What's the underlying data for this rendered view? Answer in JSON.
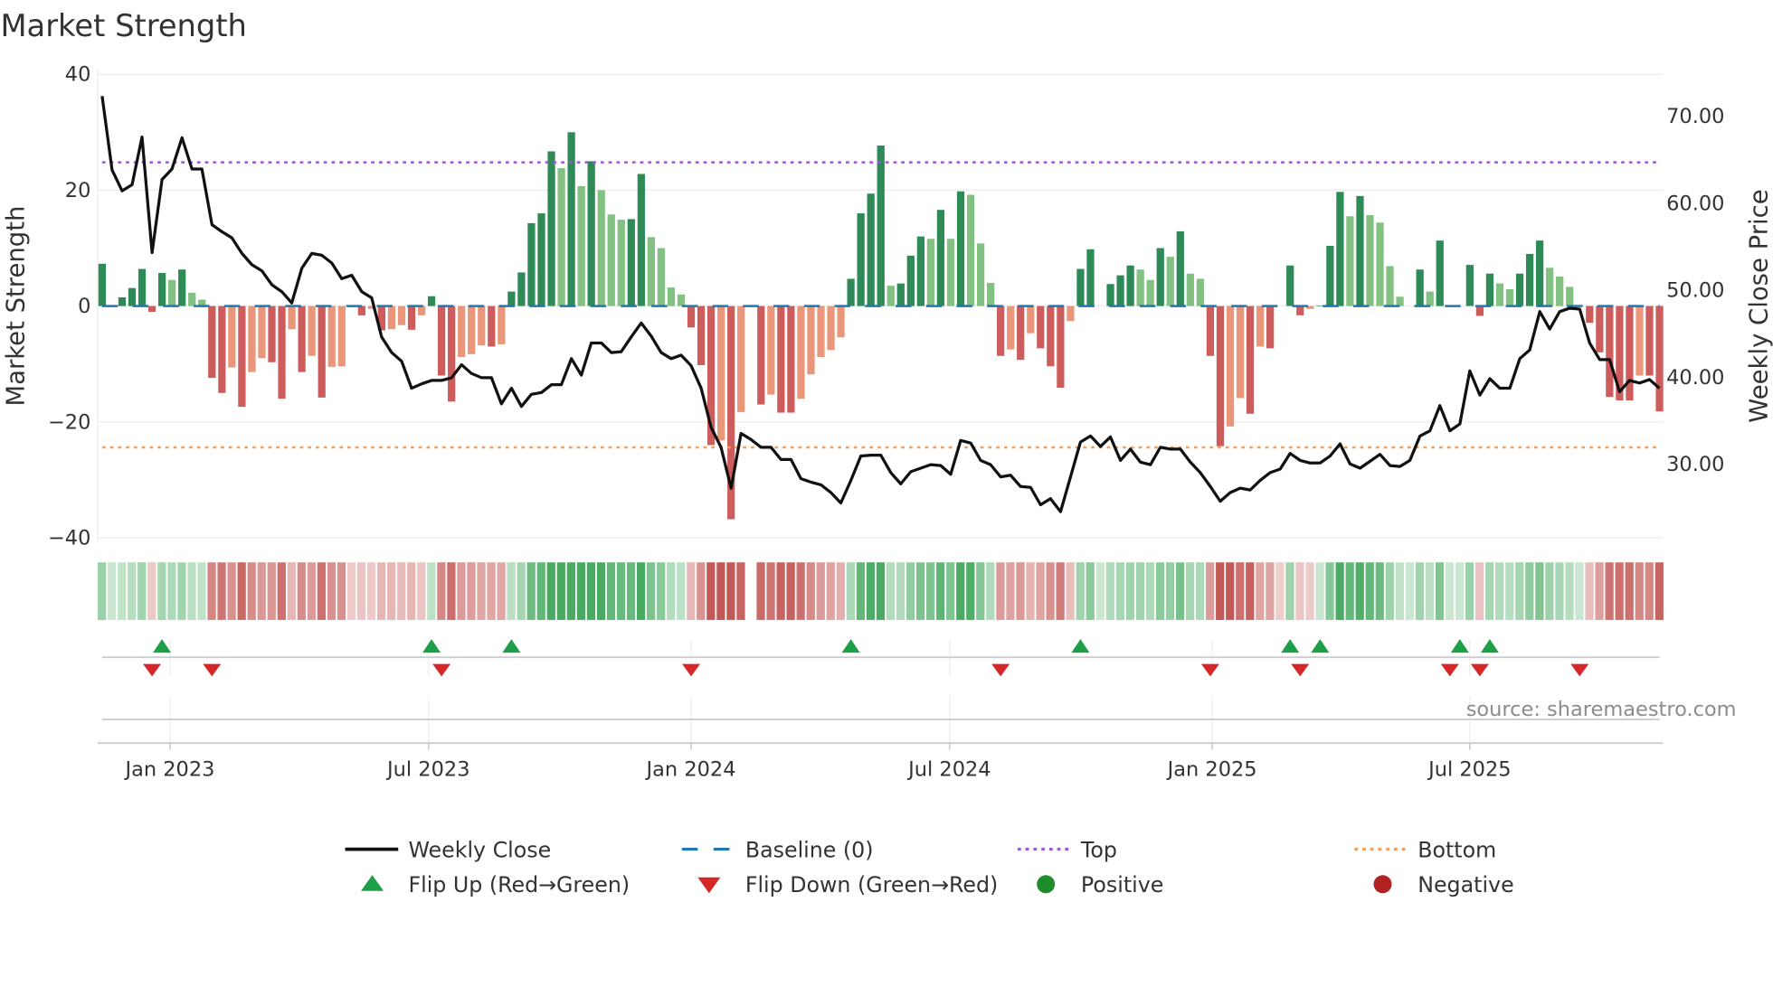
{
  "chart_data": {
    "type": "bar",
    "title": "Market Strength",
    "ylabel": "Market Strength",
    "y2label": "Weekly Close Price",
    "ylim": [
      -40,
      40
    ],
    "y2lim": [
      21.1,
      73.3
    ],
    "yticks": [
      "40",
      "20",
      "0",
      "−20",
      "−40"
    ],
    "ytick_values": [
      40,
      20,
      0,
      -20,
      -40
    ],
    "y2ticks": [
      "70.00",
      "60.00",
      "50.00",
      "40.00",
      "30.00"
    ],
    "y2tick_values": [
      70,
      60,
      50,
      40,
      30
    ],
    "x_unit": "week index",
    "xticks": [
      {
        "label": "Jan 2023",
        "week": 6.8
      },
      {
        "label": "Jul 2023",
        "week": 32.7
      },
      {
        "label": "Jan 2024",
        "week": 59.0
      },
      {
        "label": "Jul 2024",
        "week": 84.9
      },
      {
        "label": "Jan 2025",
        "week": 111.2
      },
      {
        "label": "Jul 2025",
        "week": 137.0
      }
    ],
    "top_level": 24.8,
    "bottom_level": -24.4,
    "baseline": 0,
    "strength": [
      7.3,
      0,
      1.5,
      3.1,
      6.4,
      -1,
      5.7,
      4.5,
      6.3,
      2.3,
      1.1,
      -12.4,
      -15,
      -10.6,
      -17.4,
      -11.4,
      -9,
      -9.7,
      -16,
      -4,
      -11.4,
      -8.6,
      -15.8,
      -10.5,
      -10.4,
      -0.2,
      -1.6,
      -0.5,
      -4.2,
      -4,
      -3.3,
      -4.1,
      -1.6,
      1.7,
      -12,
      -16.5,
      -8.8,
      -8.3,
      -6.8,
      -7,
      -6.6,
      2.5,
      5.8,
      14.3,
      16,
      26.7,
      23.8,
      30,
      20.7,
      25,
      20,
      15.8,
      14.9,
      15,
      22.8,
      11.9,
      10,
      3.2,
      2,
      -3.7,
      -10.2,
      -24,
      -23.2,
      -36.8,
      -18.3,
      0,
      -17,
      -15.3,
      -18.4,
      -18.4,
      -16,
      -11.8,
      -8.8,
      -7.6,
      -5.4,
      4.7,
      16,
      19.4,
      27.7,
      3.5,
      3.9,
      8.7,
      12,
      11.6,
      16.6,
      11.6,
      19.8,
      19.2,
      10.8,
      4,
      -8.6,
      -7.5,
      -9.3,
      -4.7,
      -7.3,
      -10.4,
      -14.1,
      -2.6,
      6.4,
      9.8,
      0,
      3.8,
      5.3,
      7,
      6.3,
      4.5,
      10,
      8.5,
      12.9,
      5.6,
      4.7,
      -8.6,
      -24.2,
      -20.8,
      -15.9,
      -18.6,
      -7,
      -7.3,
      0,
      7,
      -1.6,
      -0.5,
      0.1,
      10.4,
      19.7,
      15.5,
      19,
      15.7,
      14.4,
      6.9,
      1.6,
      0,
      6.3,
      2.5,
      11.3,
      0,
      0,
      7.1,
      -1.7,
      5.6,
      3.9,
      2.9,
      5.6,
      9,
      11.3,
      6.6,
      5.1,
      3.3,
      0,
      -2.9,
      -8,
      -15.7,
      -16.3,
      -16.3,
      -12,
      -12,
      -18.2
    ],
    "weekly_close": [
      72.2,
      63.7,
      61.3,
      62.0,
      67.5,
      54.2,
      62.6,
      63.8,
      67.4,
      63.8,
      63.8,
      57.4,
      56.6,
      55.9,
      54.1,
      52.8,
      52.1,
      50.5,
      49.7,
      48.4,
      52.4,
      54.1,
      53.9,
      53.0,
      51.2,
      51.6,
      49.7,
      49.0,
      44.5,
      42.7,
      41.7,
      38.6,
      39.1,
      39.5,
      39.5,
      39.8,
      41.3,
      40.3,
      39.8,
      39.8,
      36.8,
      38.6,
      36.5,
      37.9,
      38.1,
      39.0,
      39.0,
      42.0,
      40.1,
      43.8,
      43.8,
      42.7,
      42.8,
      44.5,
      46.1,
      44.6,
      42.7,
      42.0,
      42.4,
      41.2,
      38.6,
      34.1,
      31.8,
      27.1,
      33.4,
      32.7,
      31.8,
      31.8,
      30.4,
      30.4,
      28.2,
      27.8,
      27.5,
      26.6,
      25.4,
      28.0,
      30.8,
      30.9,
      30.9,
      28.9,
      27.6,
      29.0,
      29.4,
      29.8,
      29.7,
      28.7,
      32.6,
      32.3,
      30.3,
      29.8,
      28.4,
      28.6,
      27.3,
      27.2,
      25.2,
      25.9,
      24.4,
      28.4,
      32.4,
      33.1,
      31.9,
      33.0,
      30.3,
      31.6,
      30.1,
      29.8,
      31.8,
      31.6,
      31.6,
      30.1,
      28.9,
      27.3,
      25.6,
      26.6,
      27.1,
      26.9,
      28.0,
      28.9,
      29.3,
      31.1,
      30.3,
      30.0,
      30.0,
      30.8,
      32.2,
      29.9,
      29.4,
      30.2,
      31.0,
      29.7,
      29.6,
      30.3,
      33.1,
      33.7,
      36.6,
      33.7,
      34.5,
      40.6,
      37.8,
      39.7,
      38.6,
      38.6,
      42.0,
      43.0,
      47.4,
      45.4,
      47.4,
      47.8,
      47.7,
      43.8,
      41.9,
      41.9,
      38.2,
      39.5,
      39.2,
      39.6,
      38.6
    ],
    "flip_up_weeks": [
      6,
      33,
      41,
      75,
      98,
      119,
      122,
      136,
      139
    ],
    "flip_down_weeks": [
      5,
      11,
      34,
      59,
      90,
      111,
      120,
      135,
      138,
      148
    ],
    "legend": [
      {
        "label": "Weekly Close",
        "kind": "line",
        "color": "#111111"
      },
      {
        "label": "Baseline (0)",
        "kind": "dash",
        "color": "#1f77b4"
      },
      {
        "label": "Top",
        "kind": "dot",
        "color": "#9b59d0"
      },
      {
        "label": "Bottom",
        "kind": "dot",
        "color": "#f0a060"
      },
      {
        "label": "Flip Up (Red→Green)",
        "kind": "tri-up",
        "color": "#1e9e46"
      },
      {
        "label": "Flip Down (Green→Red)",
        "kind": "tri-down",
        "color": "#d62728"
      },
      {
        "label": "Positive",
        "kind": "circle",
        "color": "#1e8c2a"
      },
      {
        "label": "Negative",
        "kind": "circle",
        "color": "#b22222"
      }
    ],
    "legend_placement": "bottom",
    "colors": {
      "pos_rising": "#2e8b57",
      "pos_falling": "#82c182",
      "neg_falling": "#cd5c5c",
      "neg_rising": "#e9967a",
      "strip_pos": "#3fa65a",
      "strip_neg": "#c0504d"
    }
  },
  "source": "source: sharemaestro.com"
}
